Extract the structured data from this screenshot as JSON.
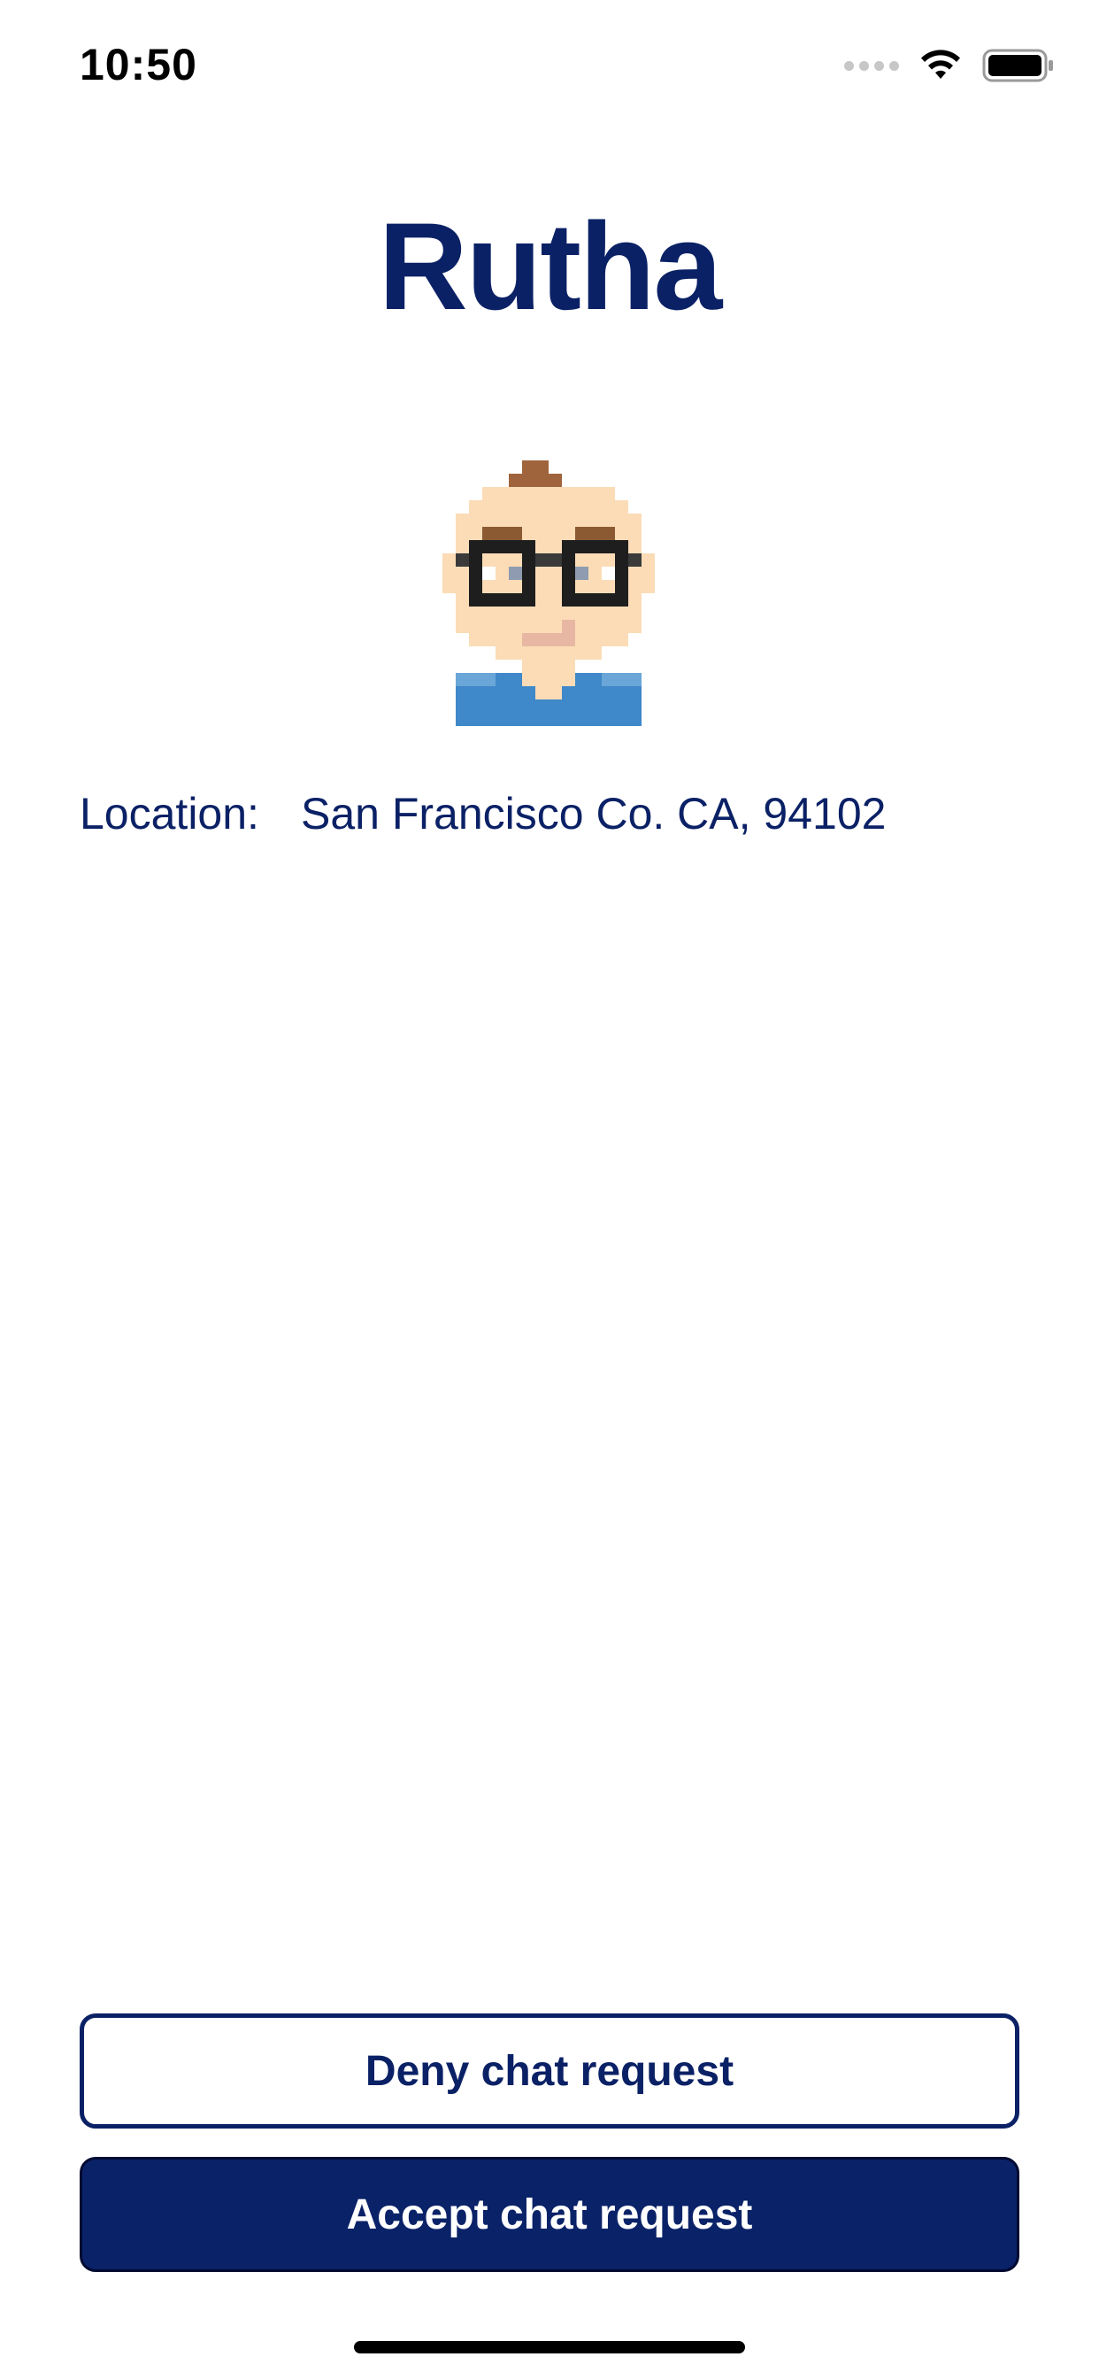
{
  "status_bar": {
    "time": "10:50",
    "icons": [
      "cellular-signal-icon",
      "wifi-icon",
      "battery-icon"
    ]
  },
  "profile": {
    "name": "Rutha",
    "avatar": "pixel-avatar-man-with-glasses",
    "location_label": "Location:",
    "location_value": "San Francisco Co. CA, 94102"
  },
  "actions": {
    "deny_label": "Deny chat request",
    "accept_label": "Accept chat request"
  },
  "colors": {
    "primary": "#0b2166",
    "accept_bg": "#0a2268",
    "background": "#ffffff"
  }
}
